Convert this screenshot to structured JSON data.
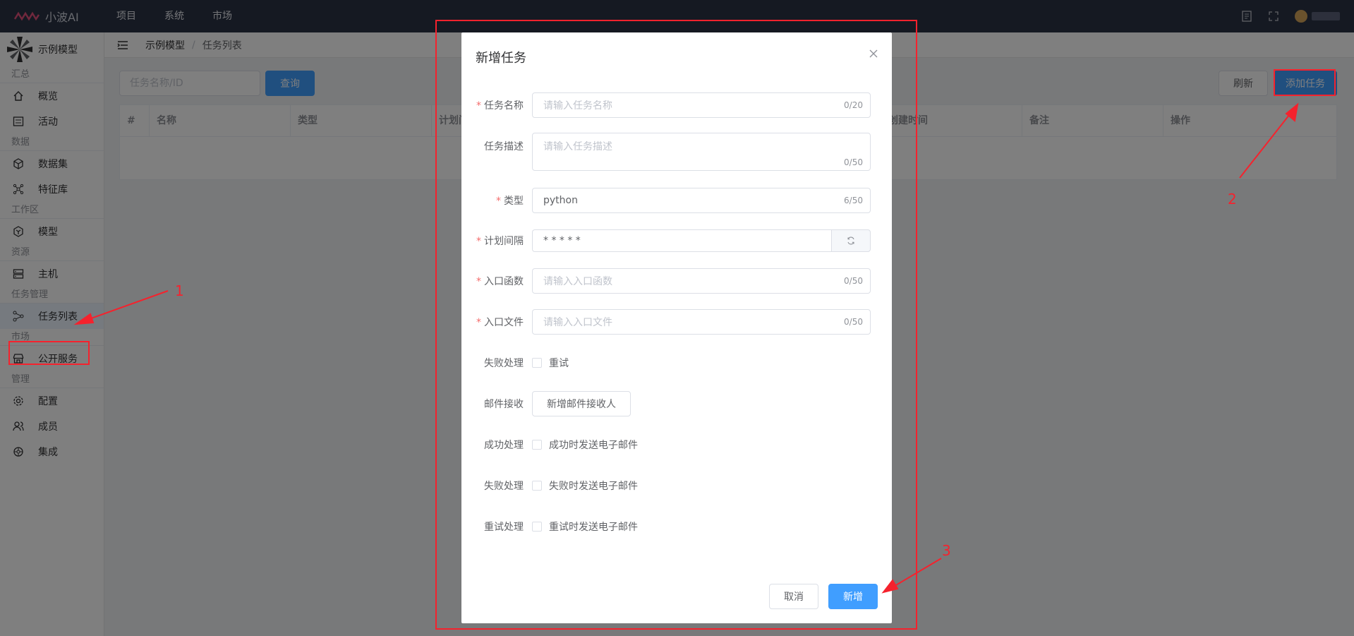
{
  "app": {
    "brand": "小波AI",
    "nav": [
      "项目",
      "系统",
      "市场"
    ]
  },
  "sidebar": {
    "project_name": "示例模型",
    "groups": [
      {
        "title": "汇总",
        "items": [
          {
            "label": "概览",
            "icon": "home-icon"
          },
          {
            "label": "活动",
            "icon": "activity-icon"
          }
        ]
      },
      {
        "title": "数据",
        "items": [
          {
            "label": "数据集",
            "icon": "cube-icon"
          },
          {
            "label": "特征库",
            "icon": "molecule-icon"
          }
        ]
      },
      {
        "title": "工作区",
        "items": [
          {
            "label": "模型",
            "icon": "model-icon"
          }
        ]
      },
      {
        "title": "资源",
        "items": [
          {
            "label": "主机",
            "icon": "server-icon"
          }
        ]
      },
      {
        "title": "任务管理",
        "items": [
          {
            "label": "任务列表",
            "icon": "share-icon",
            "active": true
          }
        ]
      },
      {
        "title": "市场",
        "items": [
          {
            "label": "公开服务",
            "icon": "store-icon"
          }
        ]
      },
      {
        "title": "管理",
        "items": [
          {
            "label": "配置",
            "icon": "gear-icon"
          },
          {
            "label": "成员",
            "icon": "users-icon"
          },
          {
            "label": "集成",
            "icon": "integration-icon"
          }
        ]
      }
    ]
  },
  "breadcrumb": [
    "示例模型",
    "任务列表"
  ],
  "toolbar": {
    "search_placeholder": "任务名称/ID",
    "query_label": "查询",
    "refresh_label": "刷新",
    "add_label": "添加任务"
  },
  "table": {
    "columns": [
      "#",
      "名称",
      "类型",
      "计划间隔",
      "",
      "",
      "",
      "",
      "创建时间",
      "备注",
      "操作"
    ]
  },
  "dialog": {
    "title": "新增任务",
    "fields": {
      "name": {
        "label": "任务名称",
        "required": true,
        "placeholder": "请输入任务名称",
        "count": "0/20"
      },
      "desc": {
        "label": "任务描述",
        "required": false,
        "placeholder": "请输入任务描述",
        "count": "0/50"
      },
      "type": {
        "label": "类型",
        "required": true,
        "value": "python",
        "count": "6/50"
      },
      "cron": {
        "label": "计划间隔",
        "required": true,
        "value": "* * * * *"
      },
      "entry_func": {
        "label": "入口函数",
        "required": true,
        "placeholder": "请输入入口函数",
        "count": "0/50"
      },
      "entry_file": {
        "label": "入口文件",
        "required": true,
        "placeholder": "请输入入口文件",
        "count": "0/50"
      },
      "fail": {
        "label": "失败处理",
        "option": "重试"
      },
      "mail": {
        "label": "邮件接收",
        "button": "新增邮件接收人"
      },
      "success_mail": {
        "label": "成功处理",
        "option": "成功时发送电子邮件"
      },
      "fail_mail": {
        "label": "失败处理",
        "option": "失败时发送电子邮件"
      },
      "retry_mail": {
        "label": "重试处理",
        "option": "重试时发送电子邮件"
      }
    },
    "cancel_label": "取消",
    "confirm_label": "新增"
  },
  "annotations": {
    "n1": "1",
    "n2": "2",
    "n3": "3",
    "color": "#f5222d"
  },
  "colors": {
    "topbar": "#2b3245",
    "primary": "#409eff",
    "danger": "#f56c6c"
  }
}
